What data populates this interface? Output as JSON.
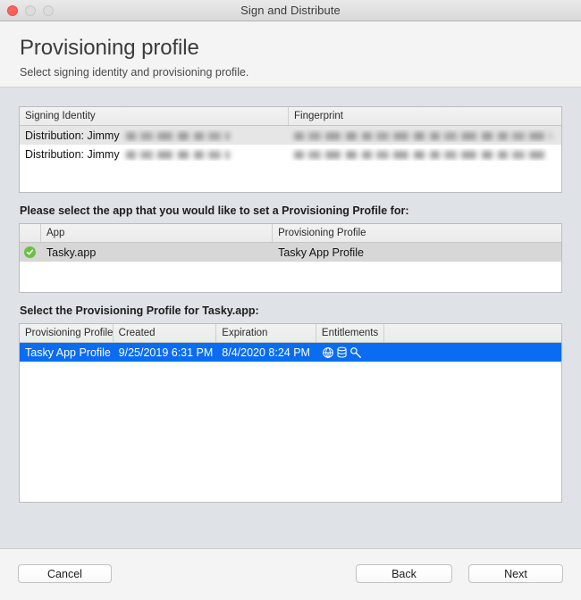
{
  "window": {
    "title": "Sign and Distribute",
    "traffic_lights": [
      "close",
      "minimize",
      "maximize"
    ]
  },
  "header": {
    "title": "Provisioning profile",
    "subtitle": "Select signing identity and provisioning profile."
  },
  "identity_table": {
    "columns": [
      "Signing Identity",
      "Fingerprint"
    ],
    "rows": [
      {
        "identity": "Distribution: Jimmy",
        "identity_redacted": true,
        "fingerprint_redacted": true,
        "selected": true
      },
      {
        "identity": "Distribution: Jimmy",
        "identity_redacted": true,
        "fingerprint_redacted": true,
        "selected": false
      }
    ]
  },
  "app_section": {
    "label": "Please select the app that you would like to set a Provisioning Profile for:",
    "columns": [
      "",
      "App",
      "Provisioning Profile"
    ],
    "rows": [
      {
        "status_icon": "check-circle-icon",
        "app": "Tasky.app",
        "profile": "Tasky App Profile",
        "selected": true
      }
    ]
  },
  "profile_section": {
    "label": "Select the Provisioning Profile for Tasky.app:",
    "columns": [
      "Provisioning Profile",
      "Created",
      "Expiration",
      "Entitlements",
      ""
    ],
    "rows": [
      {
        "profile": "Tasky App Profile",
        "created": "9/25/2019 6:31 PM",
        "expiration": "8/4/2020 8:24 PM",
        "entitlement_icons": [
          "network-globe-icon",
          "database-stack-icon",
          "key-icon"
        ],
        "selected": true
      }
    ]
  },
  "footer": {
    "cancel_label": "Cancel",
    "back_label": "Back",
    "next_label": "Next"
  },
  "colors": {
    "selection_blue": "#0a6cf0",
    "selection_grey": "#d7d7d7",
    "check_green": "#68c142",
    "window_background": "#dfe3e8",
    "header_background": "#f4f4f4",
    "close_red": "#ff6159"
  }
}
